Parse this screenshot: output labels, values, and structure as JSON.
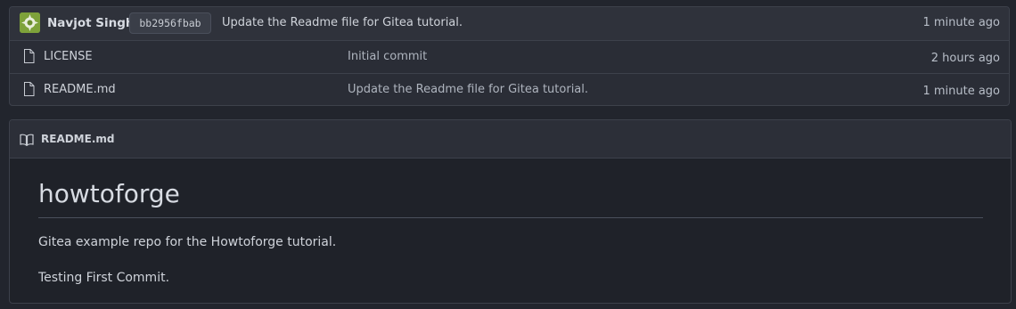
{
  "latest_commit": {
    "author": "Navjot Singh",
    "sha": "bb2956fbab",
    "message": "Update the Readme file for Gitea tutorial.",
    "time": "1 minute ago",
    "avatar_icon": "identicon-avatar"
  },
  "files": [
    {
      "icon": "file-icon",
      "name": "LICENSE",
      "last_commit": "Initial commit",
      "time": "2 hours ago"
    },
    {
      "icon": "file-icon",
      "name": "README.md",
      "last_commit": "Update the Readme file for Gitea tutorial.",
      "time": "1 minute ago"
    }
  ],
  "readme": {
    "icon": "book-icon",
    "filename": "README.md",
    "title": "howtoforge",
    "paragraphs": [
      "Gitea example repo for the Howtoforge tutorial.",
      "Testing First Commit."
    ]
  },
  "colors": {
    "background": "#22252d",
    "panel": "#2a2d36",
    "border": "#3d414b",
    "avatar": "#7ea23a"
  }
}
